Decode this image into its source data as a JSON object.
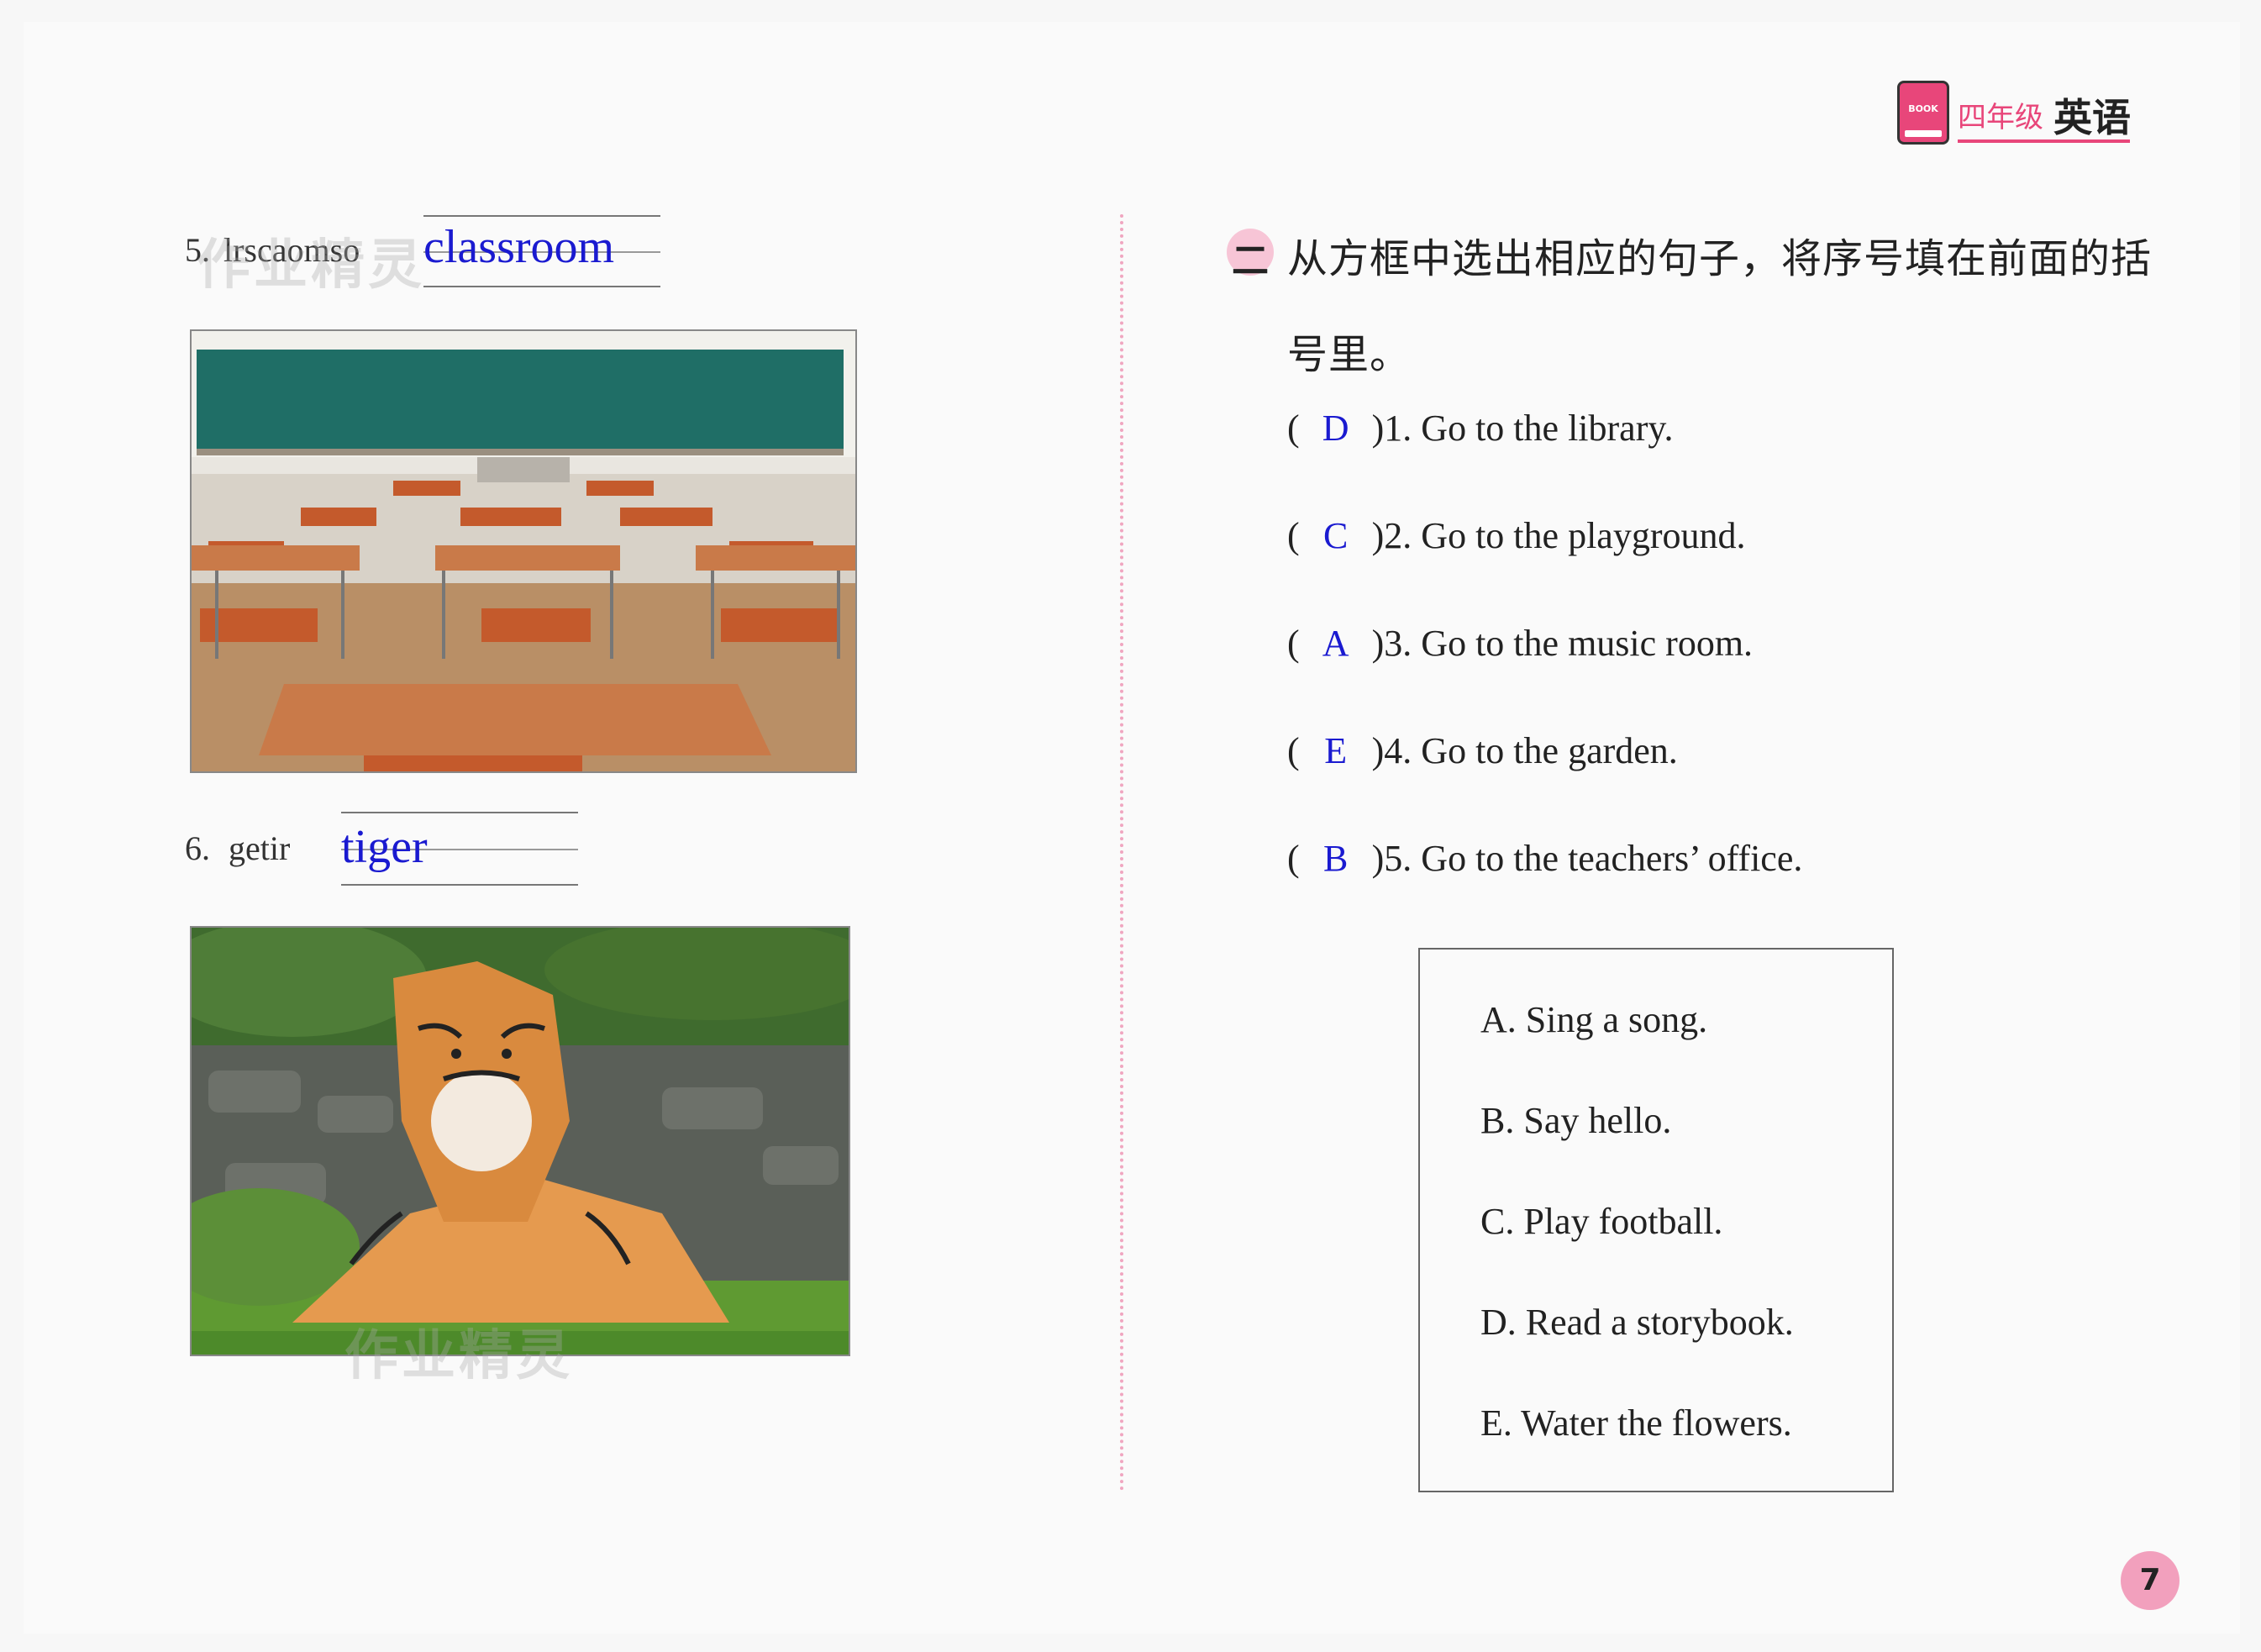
{
  "header": {
    "icon_text": "BOOK",
    "grade": "四年级",
    "subject": "英语"
  },
  "left": {
    "items": [
      {
        "number": "5.",
        "scrambled": "lrscaomso",
        "answer": "classroom",
        "image": "classroom-photo"
      },
      {
        "number": "6.",
        "scrambled": "getir",
        "answer": "tiger",
        "image": "tiger-photo"
      }
    ],
    "watermark": "作业精灵"
  },
  "right": {
    "section_marker": "二",
    "instruction_line1": "从方框中选出相应的句子，将序号填在前面的括",
    "instruction_line2": "号里。",
    "questions": [
      {
        "answer": "D",
        "text": ")1. Go to the library."
      },
      {
        "answer": "C",
        "text": ")2. Go to the playground."
      },
      {
        "answer": "A",
        "text": ")3. Go to the music room."
      },
      {
        "answer": "E",
        "text": ")4. Go to the garden."
      },
      {
        "answer": "B",
        "text": ")5. Go to the teachers’ office."
      }
    ],
    "options": [
      "A. Sing a song.",
      "B. Say hello.",
      "C. Play football.",
      "D. Read a storybook.",
      "E. Water the flowers."
    ]
  },
  "page_number": "7"
}
